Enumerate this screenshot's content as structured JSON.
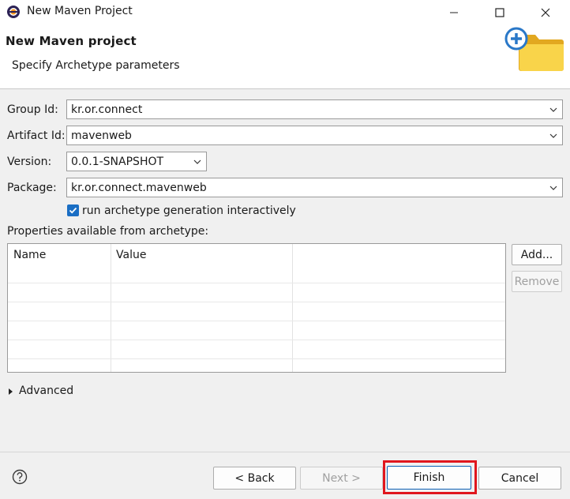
{
  "window": {
    "title": "New Maven Project"
  },
  "header": {
    "title": "New Maven project",
    "subtitle": "Specify Archetype parameters"
  },
  "form": {
    "group_id": {
      "label": "Group Id:",
      "value": "kr.or.connect"
    },
    "artifact_id": {
      "label": "Artifact Id:",
      "value": "mavenweb"
    },
    "version": {
      "label": "Version:",
      "value": "0.0.1-SNAPSHOT"
    },
    "package": {
      "label": "Package:",
      "value": "kr.or.connect.mavenweb"
    },
    "interactive": {
      "label": "run archetype generation interactively",
      "checked": true
    }
  },
  "properties": {
    "label": "Properties available from archetype:",
    "columns": [
      "Name",
      "Value"
    ],
    "rows": []
  },
  "side_buttons": {
    "add": "Add...",
    "remove": "Remove"
  },
  "advanced": {
    "label": "Advanced"
  },
  "footer": {
    "back": "< Back",
    "next": "Next >",
    "finish": "Finish",
    "cancel": "Cancel"
  },
  "colors": {
    "accent": "#1a6ec4",
    "highlight": "#e0161d"
  }
}
